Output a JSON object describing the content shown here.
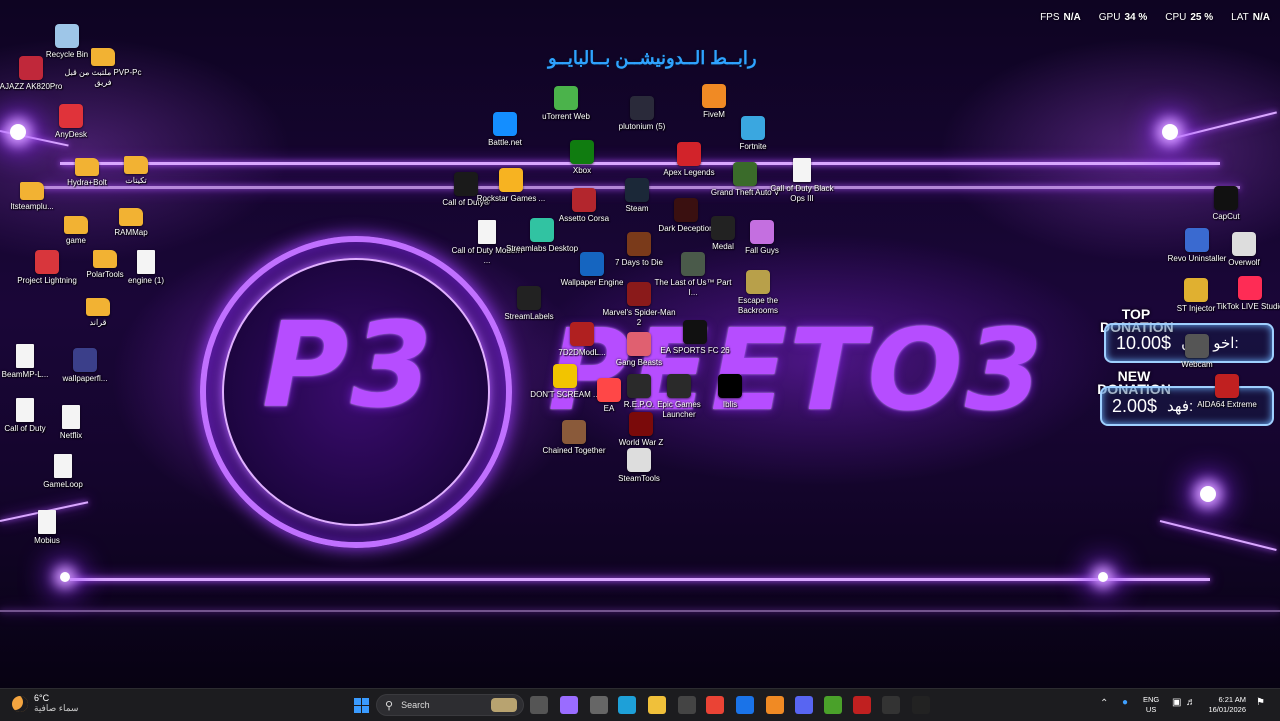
{
  "overlay": {
    "title_arabic": "رابــط الــدونيشــن بــالبايــو",
    "logo_text": "P3",
    "brand_text": "PEETO3",
    "perf": [
      {
        "label": "FPS",
        "value": "N/A"
      },
      {
        "label": "GPU",
        "value": "34 %"
      },
      {
        "label": "CPU",
        "value": "25 %"
      },
      {
        "label": "LAT",
        "value": "N/A"
      }
    ],
    "top_donation": {
      "label_line1": "TOP",
      "label_line2": "DONATION",
      "amount": "10.00$",
      "name": "اخو هتان:"
    },
    "new_donation": {
      "label_line1": "NEW",
      "label_line2": "DONATION",
      "amount": "2.00$",
      "name": "فهد:"
    }
  },
  "desktop_icons": [
    {
      "label": "Recycle Bin",
      "icon": "recycle-bin-icon",
      "color": "#9ec6e8"
    },
    {
      "label": "AJAZZ AK820Pro",
      "icon": "keyboard-icon",
      "color": "#c0283a"
    },
    {
      "label": "ملتبث من قبل PVP-Pc فريق",
      "icon": "folder-icon",
      "color": "#f2b233"
    },
    {
      "label": "AnyDesk",
      "icon": "anydesk-icon",
      "color": "#e0333a"
    },
    {
      "label": "Hydra+Bolt",
      "icon": "folder-icon",
      "color": "#f2b233"
    },
    {
      "label": "تكيتات",
      "icon": "folder-icon",
      "color": "#f2b233"
    },
    {
      "label": "Itsteamplu...",
      "icon": "folder-icon",
      "color": "#f2b233"
    },
    {
      "label": "game",
      "icon": "folder-icon",
      "color": "#f2b233"
    },
    {
      "label": "RAMMap",
      "icon": "folder-icon",
      "color": "#f2b233"
    },
    {
      "label": "Project Lightning",
      "icon": "project-lightning-icon",
      "color": "#d8363c"
    },
    {
      "label": "PolarTools",
      "icon": "folder-icon",
      "color": "#f2b233"
    },
    {
      "label": "engine (1)",
      "icon": "document-icon",
      "color": "#f4f4f4"
    },
    {
      "label": "قراند",
      "icon": "folder-icon",
      "color": "#f2b233"
    },
    {
      "label": "BeamMP-L...",
      "icon": "document-icon",
      "color": "#f4f4f4"
    },
    {
      "label": "wallpaperfl...",
      "icon": "image-icon",
      "color": "#3b3f8a"
    },
    {
      "label": "Call of Duty",
      "icon": "document-icon",
      "color": "#f4f4f4"
    },
    {
      "label": "Netflix",
      "icon": "document-icon",
      "color": "#f4f4f4"
    },
    {
      "label": "GameLoop",
      "icon": "document-icon",
      "color": "#f4f4f4"
    },
    {
      "label": "Mobius",
      "icon": "document-icon",
      "color": "#f4f4f4"
    },
    {
      "label": "uTorrent Web",
      "icon": "utorrent-icon",
      "color": "#4bb34b"
    },
    {
      "label": "plutonium (5)",
      "icon": "plutonium-icon",
      "color": "#2a2a3a"
    },
    {
      "label": "FiveM",
      "icon": "fivem-icon",
      "color": "#f08a24"
    },
    {
      "label": "Battle.net",
      "icon": "battlenet-icon",
      "color": "#148eff"
    },
    {
      "label": "Fortnite",
      "icon": "fortnite-icon",
      "color": "#3aa7e0"
    },
    {
      "label": "Xbox",
      "icon": "xbox-icon",
      "color": "#107c10"
    },
    {
      "label": "Apex Legends",
      "icon": "apex-icon",
      "color": "#d2232a"
    },
    {
      "label": "Call of Duty®",
      "icon": "cod-icon",
      "color": "#1a1a1a"
    },
    {
      "label": "Rockstar Games ...",
      "icon": "rockstar-icon",
      "color": "#f7b321"
    },
    {
      "label": "Assetto Corsa",
      "icon": "assetto-icon",
      "color": "#b3262d"
    },
    {
      "label": "Steam",
      "icon": "steam-icon",
      "color": "#1b2838"
    },
    {
      "label": "Grand Theft Auto V",
      "icon": "gta-icon",
      "color": "#3a6b2a"
    },
    {
      "label": "Call of Duty Black Ops III",
      "icon": "document-icon",
      "color": "#f4f4f4"
    },
    {
      "label": "Call of Duty Modern ...",
      "icon": "document-icon",
      "color": "#f4f4f4"
    },
    {
      "label": "Streamlabs Desktop",
      "icon": "streamlabs-icon",
      "color": "#31c3a2"
    },
    {
      "label": "Dark Deception",
      "icon": "dark-deception-icon",
      "color": "#3a1010"
    },
    {
      "label": "Medal",
      "icon": "medal-icon",
      "color": "#222222"
    },
    {
      "label": "Fall Guys",
      "icon": "fallguys-icon",
      "color": "#c46fe0"
    },
    {
      "label": "Wallpaper Engine",
      "icon": "wallpaper-engine-icon",
      "color": "#1565c0"
    },
    {
      "label": "7 Days to Die",
      "icon": "seven-days-icon",
      "color": "#7a3a1a"
    },
    {
      "label": "The Last of Us™ Part I...",
      "icon": "tlou-icon",
      "color": "#4a5a4a"
    },
    {
      "label": "Escape the Backrooms",
      "icon": "backrooms-icon",
      "color": "#b8a04a"
    },
    {
      "label": "StreamLabels",
      "icon": "streamlabels-icon",
      "color": "#222222"
    },
    {
      "label": "Marvel's Spider-Man 2",
      "icon": "spiderman-icon",
      "color": "#8a1a1a"
    },
    {
      "label": "7D2DModL...",
      "icon": "mod-icon",
      "color": "#b02020"
    },
    {
      "label": "Gang Beasts",
      "icon": "gangbeasts-icon",
      "color": "#e06070"
    },
    {
      "label": "EA SPORTS FC 26",
      "icon": "fc26-icon",
      "color": "#111111"
    },
    {
      "label": "DON'T SCREAM ...",
      "icon": "dont-scream-icon",
      "color": "#f2c400"
    },
    {
      "label": "EA",
      "icon": "ea-icon",
      "color": "#ff4747"
    },
    {
      "label": "R.E.P.O.",
      "icon": "repo-icon",
      "color": "#2a2a2a"
    },
    {
      "label": "Epic Games Launcher",
      "icon": "epic-icon",
      "color": "#2a2a2a"
    },
    {
      "label": "Iblis",
      "icon": "iblis-icon",
      "color": "#000000"
    },
    {
      "label": "Chained Together",
      "icon": "chained-icon",
      "color": "#8a5a3a"
    },
    {
      "label": "World War Z",
      "icon": "wwz-icon",
      "color": "#7a0a0a"
    },
    {
      "label": "SteamTools",
      "icon": "steamtools-icon",
      "color": "#dddddd"
    },
    {
      "label": "CapCut",
      "icon": "capcut-icon",
      "color": "#111111"
    },
    {
      "label": "Revo Uninstaller",
      "icon": "revo-icon",
      "color": "#3a6ad0"
    },
    {
      "label": "Overwolf",
      "icon": "overwolf-icon",
      "color": "#dddddd"
    },
    {
      "label": "ST Injector",
      "icon": "st-injector-icon",
      "color": "#e0b030"
    },
    {
      "label": "TikTok LIVE Studio",
      "icon": "tiktok-icon",
      "color": "#fe2c55"
    },
    {
      "label": "Webcam",
      "icon": "webcam-icon",
      "color": "#555555"
    },
    {
      "label": "AIDA64 Extreme",
      "icon": "aida64-icon",
      "color": "#c02020"
    }
  ],
  "taskbar": {
    "weather": {
      "temp": "6°C",
      "desc": "سماء صافية"
    },
    "search_placeholder": "Search",
    "apps": [
      "windows-start-icon",
      "task-view-icon",
      "copilot-icon",
      "settings-icon",
      "edge-icon",
      "file-explorer-icon",
      "store-icon",
      "chrome-icon",
      "mail-icon",
      "fivem-icon",
      "discord-icon",
      "minecraft-icon",
      "voice-icon",
      "obs-icon",
      "streamlabels-icon"
    ],
    "lang": {
      "line1": "ENG",
      "line2": "US"
    },
    "clock": {
      "time": "6:21 AM",
      "date": "16/01/2026"
    }
  }
}
